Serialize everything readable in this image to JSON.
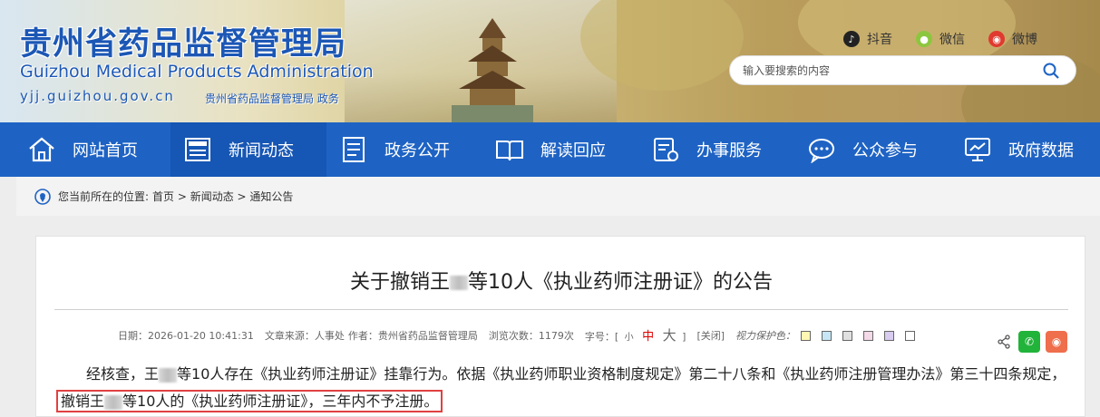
{
  "header": {
    "title_cn": "贵州省药品监督管理局",
    "title_en": "Guizhou Medical Products Administration",
    "domain": "yjj.guizhou.gov.cn",
    "subtitle": "贵州省药品监督管理局 政务",
    "social": [
      {
        "label": "抖音",
        "icon": "douyin-icon"
      },
      {
        "label": "微信",
        "icon": "wechat-icon"
      },
      {
        "label": "微博",
        "icon": "weibo-icon"
      }
    ],
    "search_placeholder": "输入要搜索的内容"
  },
  "nav": {
    "items": [
      {
        "label": "网站首页",
        "icon": "home-icon"
      },
      {
        "label": "新闻动态",
        "icon": "news-icon",
        "active": true
      },
      {
        "label": "政务公开",
        "icon": "document-icon"
      },
      {
        "label": "解读回应",
        "icon": "book-icon"
      },
      {
        "label": "办事服务",
        "icon": "service-icon"
      },
      {
        "label": "公众参与",
        "icon": "chat-icon"
      },
      {
        "label": "政府数据",
        "icon": "data-icon"
      }
    ]
  },
  "breadcrumb": {
    "prefix": "您当前所在的位置:",
    "path": "首页 > 新闻动态 > 通知公告"
  },
  "article": {
    "title_pre": "关于撤销王",
    "title_post": "等10人《执业药师注册证》的公告",
    "meta": {
      "date": "日期：2026-01-20 10:41:31",
      "source": "文章来源：人事处",
      "author": "作者：贵州省药品监督管理局",
      "views": "浏览次数：1179次",
      "fontsize_label": "字号：[",
      "small": "小",
      "medium": "中",
      "large": "大",
      "fontsize_end": "]",
      "close": "[关闭]",
      "vision": "视力保护色："
    },
    "swatch_colors": [
      "#fff7b3",
      "#c6e6f5",
      "#e0e0e0",
      "#f4d9e8",
      "#d8ccf0",
      "#ffffff"
    ],
    "para_1": "经核查，王",
    "para_2": "等10人存在《执业药师注册证》挂靠行为。依据《执业药师职业资格制度规定》第二十八条和《执业药师注册管理办法》第三十四条规定，",
    "para_hl_1": "撤销王",
    "para_hl_2": "等10人的《执业药师注册证》，三年内不予注册。"
  }
}
